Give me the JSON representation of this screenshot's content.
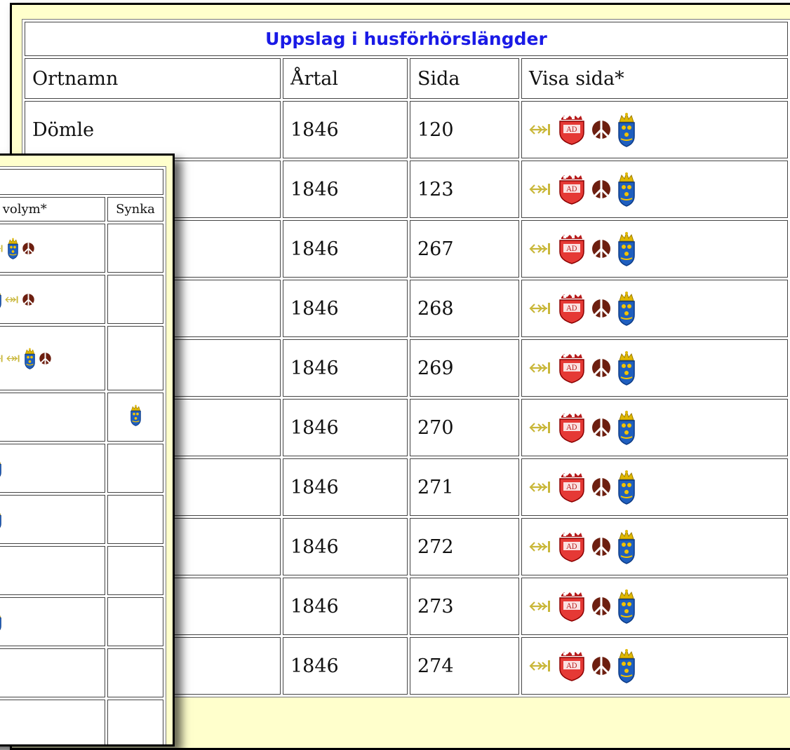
{
  "main_table": {
    "title": "Uppslag i husförhörslängder",
    "headers": [
      "Ortnamn",
      "Årtal",
      "Sida",
      "Visa sida*"
    ],
    "rows": [
      {
        "ortnamn": "Dömle",
        "artal": "1846",
        "sida": "120"
      },
      {
        "ortnamn": "",
        "artal": "1846",
        "sida": "123"
      },
      {
        "ortnamn": "",
        "artal": "1846",
        "sida": "267"
      },
      {
        "ortnamn": "",
        "artal": "1846",
        "sida": "268"
      },
      {
        "ortnamn": "",
        "artal": "1846",
        "sida": "269"
      },
      {
        "ortnamn": "",
        "artal": "1846",
        "sida": "270"
      },
      {
        "ortnamn": "",
        "artal": "1846",
        "sida": "271"
      },
      {
        "ortnamn": "",
        "artal": "1846",
        "sida": "272"
      },
      {
        "ortnamn": "",
        "artal": "1846",
        "sida": "273"
      },
      {
        "ortnamn": "",
        "artal": "1846",
        "sida": "274"
      }
    ],
    "row_icons": [
      "arkiv-digital-arrow-icon",
      "arkiv-digital-shield-icon",
      "svar-emblem-icon",
      "riksarkivet-crest-icon"
    ]
  },
  "side_table": {
    "headers": [
      "sa volym*",
      "Synka"
    ]
  },
  "colors": {
    "panel_bg": "#ffffcc",
    "title_blue": "#1a1ae6",
    "border": "#000000"
  }
}
